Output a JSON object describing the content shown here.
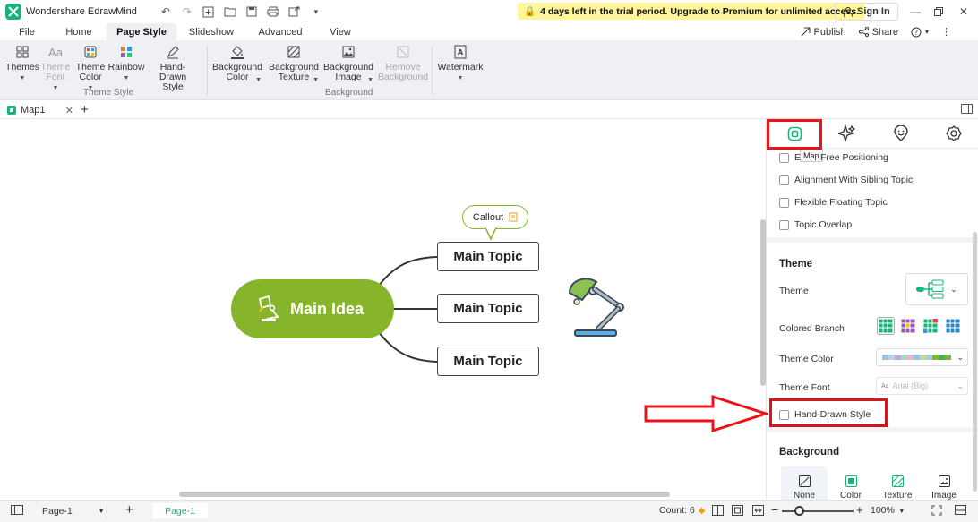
{
  "app": {
    "title": "Wondershare EdrawMind"
  },
  "trial": {
    "text": "4 days left in the trial period. Upgrade to Premium for unlimited access."
  },
  "account": {
    "signin": "Sign In"
  },
  "menu": {
    "tabs": [
      "File",
      "Home",
      "Page Style",
      "Slideshow",
      "Advanced",
      "View"
    ],
    "active": "Page Style",
    "publish": "Publish",
    "share": "Share"
  },
  "ribbon": {
    "themes": "Themes",
    "theme_font_1": "Theme",
    "theme_font_2": "Font",
    "theme_color_1": "Theme",
    "theme_color_2": "Color",
    "rainbow": "Rainbow",
    "hand_drawn_1": "Hand-Drawn",
    "hand_drawn_2": "Style",
    "group_theme": "Theme Style",
    "bg_color_1": "Background",
    "bg_color_2": "Color",
    "bg_texture_1": "Background",
    "bg_texture_2": "Texture",
    "bg_image_1": "Background",
    "bg_image_2": "Image",
    "remove_bg_1": "Remove",
    "remove_bg_2": "Background",
    "group_bg": "Background",
    "watermark": "Watermark"
  },
  "doc": {
    "tab": "Map1"
  },
  "mindmap": {
    "main_idea": "Main Idea",
    "topics": [
      "Main Topic",
      "Main Topic",
      "Main Topic"
    ],
    "callout": "Callout",
    "main_color": "#86b52c"
  },
  "panel": {
    "tooltip": "Map",
    "free_positioning": "Free Positioning",
    "free_prefix": "E",
    "alignment": "Alignment With Sibling Topic",
    "flexible": "Flexible Floating Topic",
    "overlap": "Topic Overlap",
    "theme_section": "Theme",
    "theme_label": "Theme",
    "colored_branch": "Colored Branch",
    "theme_color": "Theme Color",
    "theme_font": "Theme Font",
    "theme_font_value": "Arial (Big)",
    "hand_drawn": "Hand-Drawn Style",
    "bg_section": "Background",
    "bg_options": [
      "None",
      "Color",
      "Texture",
      "Image"
    ]
  },
  "status": {
    "page_select": "Page-1",
    "page_tab": "Page-1",
    "count": "Count: 6",
    "zoom": "100%"
  },
  "colors": {
    "accent_green": "#86b52c",
    "highlight_red": "#e8141b",
    "trial_yellow": "#fff59a"
  }
}
